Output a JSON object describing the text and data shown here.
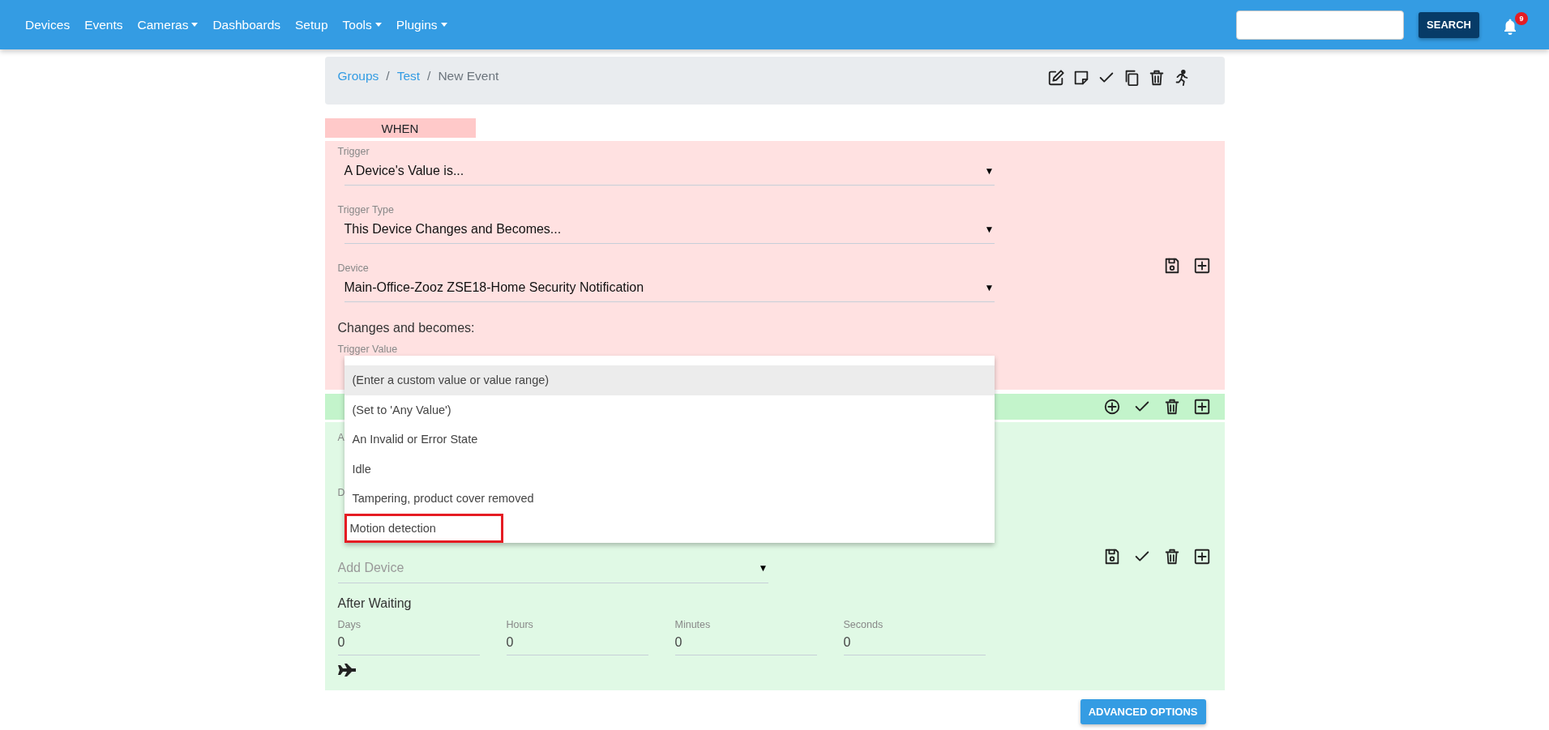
{
  "nav": {
    "items": [
      {
        "label": "Devices",
        "caret": false
      },
      {
        "label": "Events",
        "caret": false
      },
      {
        "label": "Cameras",
        "caret": true
      },
      {
        "label": "Dashboards",
        "caret": false
      },
      {
        "label": "Setup",
        "caret": false
      },
      {
        "label": "Tools",
        "caret": true
      },
      {
        "label": "Plugins",
        "caret": true
      }
    ],
    "search_button": "SEARCH",
    "notification_count": "9"
  },
  "breadcrumb": {
    "items": [
      {
        "label": "Groups",
        "link": true
      },
      {
        "label": "Test",
        "link": true
      },
      {
        "label": "New Event",
        "link": false
      }
    ],
    "separator": "/",
    "toolbar": [
      {
        "kind": "edit"
      },
      {
        "kind": "note"
      },
      {
        "kind": "check"
      },
      {
        "kind": "copy"
      },
      {
        "kind": "trash"
      },
      {
        "kind": "run"
      }
    ]
  },
  "when": {
    "tab": "WHEN",
    "fields": [
      {
        "label": "Trigger",
        "value": "A Device's Value is...",
        "arrow": "▼"
      },
      {
        "label": "Trigger Type",
        "value": "This Device Changes and Becomes...",
        "arrow": "▼"
      },
      {
        "label": "Device",
        "value": "Main-Office-Zooz ZSE18-Home Security Notification",
        "arrow": "▼"
      }
    ],
    "heading": "Changes and becomes:",
    "trigger_value": {
      "label": "Trigger Value",
      "options": [
        {
          "label": "(Enter a custom value or value range)",
          "selected": true,
          "highlighted": false
        },
        {
          "label": "(Set to 'Any Value')",
          "selected": false,
          "highlighted": false
        },
        {
          "label": "An Invalid or Error State",
          "selected": false,
          "highlighted": false
        },
        {
          "label": "Idle",
          "selected": false,
          "highlighted": false
        },
        {
          "label": "Tampering, product cover removed",
          "selected": false,
          "highlighted": false
        },
        {
          "label": "Motion detection",
          "selected": false,
          "highlighted": true
        }
      ]
    },
    "actions": [
      {
        "kind": "save"
      },
      {
        "kind": "add"
      }
    ]
  },
  "condition_bar": {
    "actions": [
      {
        "kind": "add-circle"
      },
      {
        "kind": "check"
      },
      {
        "kind": "trash"
      },
      {
        "kind": "add"
      }
    ]
  },
  "then": {
    "covered_labels": [
      "A",
      "D"
    ],
    "add_device": {
      "placeholder": "Add Device",
      "arrow": "▼"
    },
    "heading": "After Waiting",
    "delays": [
      {
        "label": "Days",
        "value": "0"
      },
      {
        "label": "Hours",
        "value": "0"
      },
      {
        "label": "Minutes",
        "value": "0"
      },
      {
        "label": "Seconds",
        "value": "0"
      }
    ],
    "actions": [
      {
        "kind": "save"
      },
      {
        "kind": "check"
      },
      {
        "kind": "trash"
      },
      {
        "kind": "add"
      }
    ]
  },
  "advanced_button": "ADVANCED OPTIONS"
}
